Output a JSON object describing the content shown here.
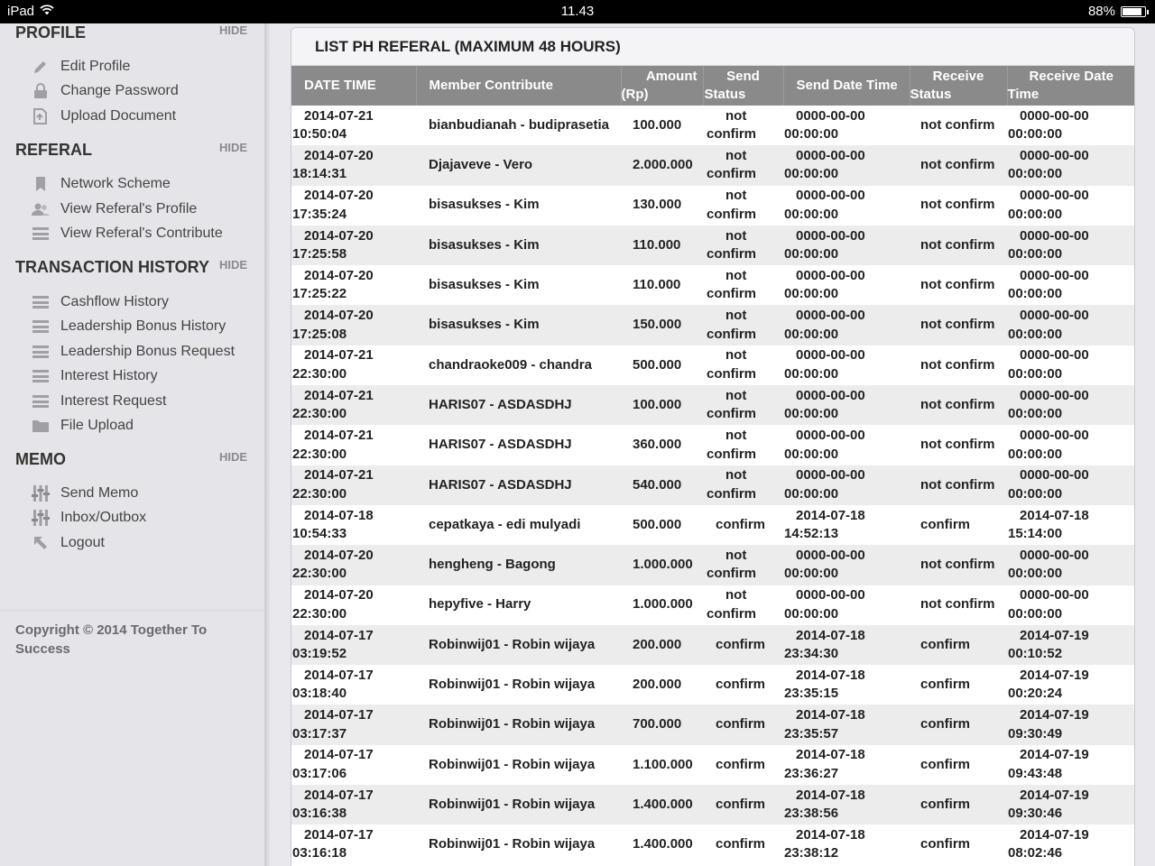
{
  "statusbar": {
    "device": "iPad",
    "time": "11.43",
    "battery": "88%",
    "battery_level": 0.88
  },
  "sidebar": {
    "sections": [
      {
        "title": "PROFILE",
        "hide": "HIDE",
        "items": [
          {
            "label": "Edit Profile",
            "icon": "pencil-icon"
          },
          {
            "label": "Change Password",
            "icon": "lock-icon"
          },
          {
            "label": "Upload Document",
            "icon": "upload-document-icon"
          }
        ]
      },
      {
        "title": "REFERAL",
        "hide": "HIDE",
        "items": [
          {
            "label": "Network Scheme",
            "icon": "bookmark-icon"
          },
          {
            "label": "View Referal's Profile",
            "icon": "users-icon"
          },
          {
            "label": "View Referal's Contribute",
            "icon": "list-icon"
          }
        ]
      },
      {
        "title": "TRANSACTION HISTORY",
        "hide": "HIDE",
        "items": [
          {
            "label": "Cashflow History",
            "icon": "list-icon"
          },
          {
            "label": "Leadership Bonus History",
            "icon": "list-icon"
          },
          {
            "label": "Leadership Bonus Request",
            "icon": "list-icon"
          },
          {
            "label": "Interest History",
            "icon": "list-icon"
          },
          {
            "label": "Interest Request",
            "icon": "list-icon"
          },
          {
            "label": "File Upload",
            "icon": "folder-icon"
          }
        ]
      },
      {
        "title": "MEMO",
        "hide": "HIDE",
        "items": [
          {
            "label": "Send Memo",
            "icon": "sliders-icon"
          },
          {
            "label": "Inbox/Outbox",
            "icon": "sliders-icon"
          },
          {
            "label": "Logout",
            "icon": "arrow-up-left-icon"
          }
        ]
      }
    ],
    "copyright": "Copyright © 2014 Together To Success"
  },
  "main": {
    "title": "LIST PH REFERAL (MAXIMUM 48 HOURS)",
    "columns": {
      "date_time": "DATE TIME",
      "member": "Member Contribute",
      "amount_1": "Amount",
      "amount_2": "(Rp)",
      "send_status_1": "Send",
      "send_status_2": "Status",
      "send_date_time": "Send Date Time",
      "receive_status_1": "Receive",
      "receive_status_2": "Status",
      "receive_date_time_1": "Receive Date",
      "receive_date_time_2": "Time"
    },
    "rows": [
      {
        "date": "2014-07-21",
        "time": "10:50:04",
        "member": "bianbudianah - budiprasetia",
        "amount": "100.000",
        "send_status_1": "not",
        "send_status_2": "confirm",
        "send_date": "0000-00-00",
        "send_time": "00:00:00",
        "receive_status": "not confirm",
        "receive_date": "0000-00-00",
        "receive_time": "00:00:00"
      },
      {
        "date": "2014-07-20",
        "time": "18:14:31",
        "member": "Djajaveve - Vero",
        "amount": "2.000.000",
        "send_status_1": "not",
        "send_status_2": "confirm",
        "send_date": "0000-00-00",
        "send_time": "00:00:00",
        "receive_status": "not confirm",
        "receive_date": "0000-00-00",
        "receive_time": "00:00:00"
      },
      {
        "date": "2014-07-20",
        "time": "17:35:24",
        "member": "bisasukses - Kim",
        "amount": "130.000",
        "send_status_1": "not",
        "send_status_2": "confirm",
        "send_date": "0000-00-00",
        "send_time": "00:00:00",
        "receive_status": "not confirm",
        "receive_date": "0000-00-00",
        "receive_time": "00:00:00"
      },
      {
        "date": "2014-07-20",
        "time": "17:25:58",
        "member": "bisasukses - Kim",
        "amount": "110.000",
        "send_status_1": "not",
        "send_status_2": "confirm",
        "send_date": "0000-00-00",
        "send_time": "00:00:00",
        "receive_status": "not confirm",
        "receive_date": "0000-00-00",
        "receive_time": "00:00:00"
      },
      {
        "date": "2014-07-20",
        "time": "17:25:22",
        "member": "bisasukses - Kim",
        "amount": "110.000",
        "send_status_1": "not",
        "send_status_2": "confirm",
        "send_date": "0000-00-00",
        "send_time": "00:00:00",
        "receive_status": "not confirm",
        "receive_date": "0000-00-00",
        "receive_time": "00:00:00"
      },
      {
        "date": "2014-07-20",
        "time": "17:25:08",
        "member": "bisasukses - Kim",
        "amount": "150.000",
        "send_status_1": "not",
        "send_status_2": "confirm",
        "send_date": "0000-00-00",
        "send_time": "00:00:00",
        "receive_status": "not confirm",
        "receive_date": "0000-00-00",
        "receive_time": "00:00:00"
      },
      {
        "date": "2014-07-21",
        "time": "22:30:00",
        "member": "chandraoke009 - chandra",
        "amount": "500.000",
        "send_status_1": "not",
        "send_status_2": "confirm",
        "send_date": "0000-00-00",
        "send_time": "00:00:00",
        "receive_status": "not confirm",
        "receive_date": "0000-00-00",
        "receive_time": "00:00:00"
      },
      {
        "date": "2014-07-21",
        "time": "22:30:00",
        "member": "HARIS07 - ASDASDHJ",
        "amount": "100.000",
        "send_status_1": "not",
        "send_status_2": "confirm",
        "send_date": "0000-00-00",
        "send_time": "00:00:00",
        "receive_status": "not confirm",
        "receive_date": "0000-00-00",
        "receive_time": "00:00:00"
      },
      {
        "date": "2014-07-21",
        "time": "22:30:00",
        "member": "HARIS07 - ASDASDHJ",
        "amount": "360.000",
        "send_status_1": "not",
        "send_status_2": "confirm",
        "send_date": "0000-00-00",
        "send_time": "00:00:00",
        "receive_status": "not confirm",
        "receive_date": "0000-00-00",
        "receive_time": "00:00:00"
      },
      {
        "date": "2014-07-21",
        "time": "22:30:00",
        "member": "HARIS07 - ASDASDHJ",
        "amount": "540.000",
        "send_status_1": "not",
        "send_status_2": "confirm",
        "send_date": "0000-00-00",
        "send_time": "00:00:00",
        "receive_status": "not confirm",
        "receive_date": "0000-00-00",
        "receive_time": "00:00:00"
      },
      {
        "date": "2014-07-18",
        "time": "10:54:33",
        "member": "cepatkaya - edi mulyadi",
        "amount": "500.000",
        "send_status_1": "",
        "send_status_2": "confirm",
        "send_date": "2014-07-18",
        "send_time": "14:52:13",
        "receive_status": "confirm",
        "receive_date": "2014-07-18",
        "receive_time": "15:14:00"
      },
      {
        "date": "2014-07-20",
        "time": "22:30:00",
        "member": "hengheng - Bagong",
        "amount": "1.000.000",
        "send_status_1": "not",
        "send_status_2": "confirm",
        "send_date": "0000-00-00",
        "send_time": "00:00:00",
        "receive_status": "not confirm",
        "receive_date": "0000-00-00",
        "receive_time": "00:00:00"
      },
      {
        "date": "2014-07-20",
        "time": "22:30:00",
        "member": "hepyfive - Harry",
        "amount": "1.000.000",
        "send_status_1": "not",
        "send_status_2": "confirm",
        "send_date": "0000-00-00",
        "send_time": "00:00:00",
        "receive_status": "not confirm",
        "receive_date": "0000-00-00",
        "receive_time": "00:00:00"
      },
      {
        "date": "2014-07-17",
        "time": "03:19:52",
        "member": "Robinwij01 - Robin wijaya",
        "amount": "200.000",
        "send_status_1": "",
        "send_status_2": "confirm",
        "send_date": "2014-07-18",
        "send_time": "23:34:30",
        "receive_status": "confirm",
        "receive_date": "2014-07-19",
        "receive_time": "00:10:52"
      },
      {
        "date": "2014-07-17",
        "time": "03:18:40",
        "member": "Robinwij01 - Robin wijaya",
        "amount": "200.000",
        "send_status_1": "",
        "send_status_2": "confirm",
        "send_date": "2014-07-18",
        "send_time": "23:35:15",
        "receive_status": "confirm",
        "receive_date": "2014-07-19",
        "receive_time": "00:20:24"
      },
      {
        "date": "2014-07-17",
        "time": "03:17:37",
        "member": "Robinwij01 - Robin wijaya",
        "amount": "700.000",
        "send_status_1": "",
        "send_status_2": "confirm",
        "send_date": "2014-07-18",
        "send_time": "23:35:57",
        "receive_status": "confirm",
        "receive_date": "2014-07-19",
        "receive_time": "09:30:49"
      },
      {
        "date": "2014-07-17",
        "time": "03:17:06",
        "member": "Robinwij01 - Robin wijaya",
        "amount": "1.100.000",
        "send_status_1": "",
        "send_status_2": "confirm",
        "send_date": "2014-07-18",
        "send_time": "23:36:27",
        "receive_status": "confirm",
        "receive_date": "2014-07-19",
        "receive_time": "09:43:48"
      },
      {
        "date": "2014-07-17",
        "time": "03:16:38",
        "member": "Robinwij01 - Robin wijaya",
        "amount": "1.400.000",
        "send_status_1": "",
        "send_status_2": "confirm",
        "send_date": "2014-07-18",
        "send_time": "23:38:56",
        "receive_status": "confirm",
        "receive_date": "2014-07-19",
        "receive_time": "09:30:46"
      },
      {
        "date": "2014-07-17",
        "time": "03:16:18",
        "member": "Robinwij01 - Robin wijaya",
        "amount": "1.400.000",
        "send_status_1": "",
        "send_status_2": "confirm",
        "send_date": "2014-07-18",
        "send_time": "23:38:12",
        "receive_status": "confirm",
        "receive_date": "2014-07-19",
        "receive_time": "08:02:46"
      }
    ]
  }
}
